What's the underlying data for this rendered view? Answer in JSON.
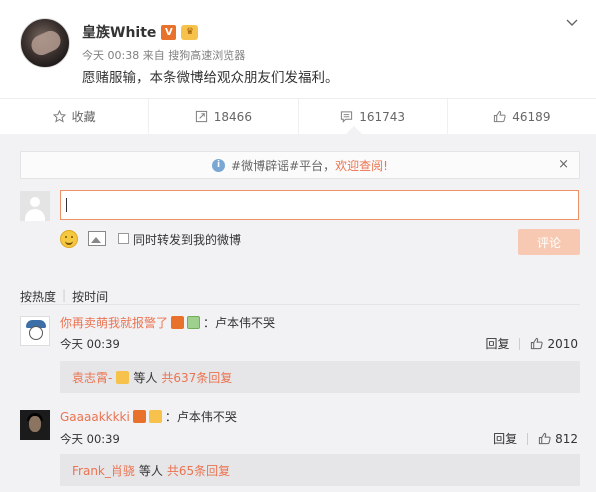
{
  "post": {
    "author": "皇族White",
    "verified_badge": "V",
    "time": "今天 00:38",
    "source_prefix": "来自",
    "source": "搜狗高速浏览器",
    "text": "愿赌服输，本条微博给观众朋友们发福利。"
  },
  "actions": {
    "favorite": "收藏",
    "repost": "18466",
    "comment": "161743",
    "like": "46189"
  },
  "notice": {
    "prefix": "#微博辟谣#平台，",
    "link": "欢迎查阅!",
    "close": "×"
  },
  "composer": {
    "input_value": "",
    "also_repost_label": "同时转发到我的微博",
    "submit_label": "评论"
  },
  "sort": {
    "by_hot": "按热度",
    "by_time": "按时间"
  },
  "comments": [
    {
      "user": "你再卖萌我就报警了",
      "text": "：卢本伟不哭",
      "time": "今天 00:39",
      "reply_label": "回复",
      "likes": "2010",
      "replies": {
        "user": "袁志霄-",
        "suffix": "等人",
        "more": "共637条回复"
      }
    },
    {
      "user": "Gaaaakkkki",
      "text": "：卢本伟不哭",
      "time": "今天 00:39",
      "reply_label": "回复",
      "likes": "812",
      "replies": {
        "user": "Frank_肖骁",
        "suffix": "等人",
        "more": "共65条回复"
      }
    }
  ],
  "colors": {
    "accent": "#eb7350",
    "input_border": "#ec9264",
    "submit_disabled": "#f8c9b2",
    "panel_bg": "#f2f2f5"
  }
}
